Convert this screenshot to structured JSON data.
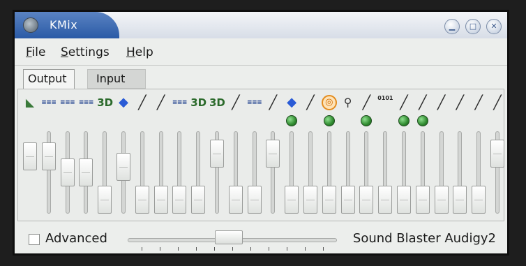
{
  "window": {
    "title": "KMix",
    "buttons": {
      "minimize": "▁",
      "maximize": "□",
      "close": "✕"
    }
  },
  "menu": [
    {
      "key": "file",
      "prefix": "",
      "underlined": "F",
      "rest": "ile"
    },
    {
      "key": "settings",
      "prefix": "",
      "underlined": "S",
      "rest": "ettings"
    },
    {
      "key": "help",
      "prefix": "",
      "underlined": "H",
      "rest": "elp"
    }
  ],
  "tabs": [
    {
      "key": "output",
      "label": "Output",
      "active": true
    },
    {
      "key": "input",
      "label": "Input",
      "active": false
    }
  ],
  "channels": [
    {
      "icon": "corner",
      "glyph": "◣",
      "led": false,
      "level": 0.8,
      "track": false
    },
    {
      "icon": "text",
      "glyph": "≡≡≡",
      "led": false,
      "level": 0.8
    },
    {
      "icon": "text",
      "glyph": "≡≡≡",
      "led": false,
      "level": 0.5
    },
    {
      "icon": "text",
      "glyph": "≡≡≡",
      "led": false,
      "level": 0.5
    },
    {
      "icon": "3d",
      "glyph": "3D",
      "led": false,
      "level": 0.0
    },
    {
      "icon": "blue",
      "glyph": "◆",
      "led": false,
      "level": 0.6
    },
    {
      "icon": "jack",
      "glyph": "╱",
      "led": false,
      "level": 0.0
    },
    {
      "icon": "jack",
      "glyph": "╱",
      "led": false,
      "level": 0.0
    },
    {
      "icon": "text",
      "glyph": "≡≡≡",
      "led": false,
      "level": 0.0
    },
    {
      "icon": "3d",
      "glyph": "3D",
      "led": false,
      "level": 0.0
    },
    {
      "icon": "3d",
      "glyph": "3D",
      "led": false,
      "level": 0.85
    },
    {
      "icon": "jack",
      "glyph": "╱",
      "led": false,
      "level": 0.0
    },
    {
      "icon": "text",
      "glyph": "≡≡≡",
      "led": false,
      "level": 0.0
    },
    {
      "icon": "jack",
      "glyph": "╱",
      "led": false,
      "level": 0.85
    },
    {
      "icon": "blue",
      "glyph": "◆",
      "led": true,
      "level": 0.0
    },
    {
      "icon": "jack",
      "glyph": "╱",
      "led": false,
      "level": 0.0
    },
    {
      "icon": "orange",
      "glyph": "◎",
      "led": true,
      "level": 0.0
    },
    {
      "icon": "mic",
      "glyph": "⚲",
      "led": false,
      "level": 0.0
    },
    {
      "icon": "jack",
      "glyph": "╱",
      "led": true,
      "level": 0.0
    },
    {
      "icon": "digits",
      "glyph": "0101",
      "led": false,
      "level": 0.0
    },
    {
      "icon": "jack",
      "glyph": "╱",
      "led": true,
      "level": 0.0
    },
    {
      "icon": "jack",
      "glyph": "╱",
      "led": true,
      "level": 0.0
    },
    {
      "icon": "jack",
      "glyph": "╱",
      "led": false,
      "level": 0.0
    },
    {
      "icon": "jack",
      "glyph": "╱",
      "led": false,
      "level": 0.0
    },
    {
      "icon": "jack",
      "glyph": "╱",
      "led": false,
      "level": 0.0
    },
    {
      "icon": "jack",
      "glyph": "╱",
      "led": false,
      "level": 0.85
    }
  ],
  "bottom": {
    "advanced_label": "Advanced",
    "advanced_checked": false,
    "master_level": 0.48,
    "master_ticks": 11,
    "soundcard": "Sound Blaster Audigy2"
  }
}
